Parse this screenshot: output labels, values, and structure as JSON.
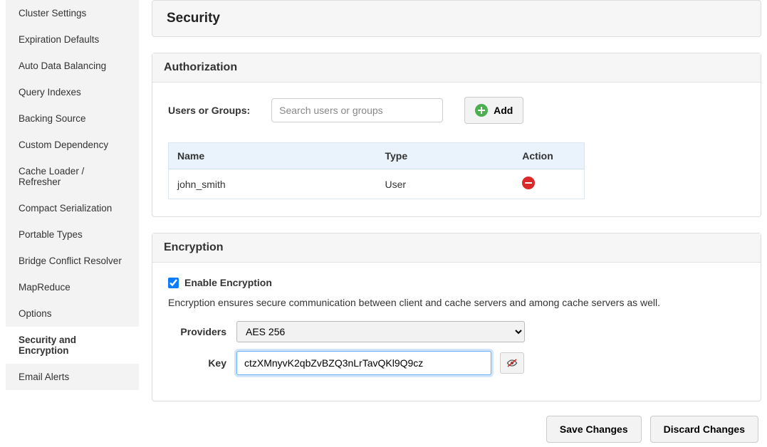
{
  "sidebar": {
    "items": [
      {
        "label": "Cluster Settings"
      },
      {
        "label": "Expiration Defaults"
      },
      {
        "label": "Auto Data Balancing"
      },
      {
        "label": "Query Indexes"
      },
      {
        "label": "Backing Source"
      },
      {
        "label": "Custom Dependency"
      },
      {
        "label": "Cache Loader / Refresher"
      },
      {
        "label": "Compact Serialization"
      },
      {
        "label": "Portable Types"
      },
      {
        "label": "Bridge Conflict Resolver"
      },
      {
        "label": "MapReduce"
      },
      {
        "label": "Options"
      },
      {
        "label": "Security and Encryption"
      },
      {
        "label": "Email Alerts"
      }
    ],
    "active_index": 12
  },
  "page": {
    "title": "Security"
  },
  "authorization": {
    "title": "Authorization",
    "label": "Users or Groups:",
    "search_placeholder": "Search users or groups",
    "add_label": "Add",
    "table": {
      "headers": {
        "name": "Name",
        "type": "Type",
        "action": "Action"
      },
      "rows": [
        {
          "name": "john_smith",
          "type": "User"
        }
      ]
    }
  },
  "encryption": {
    "title": "Encryption",
    "enable_label": "Enable Encryption",
    "enabled": true,
    "description": "Encryption ensures secure communication between client and cache servers and among cache servers as well.",
    "providers_label": "Providers",
    "provider_selected": "AES 256",
    "key_label": "Key",
    "key_value": "ctzXMnyvK2qbZvBZQ3nLrTavQKl9Q9cz"
  },
  "footer": {
    "save_label": "Save Changes",
    "discard_label": "Discard Changes"
  }
}
